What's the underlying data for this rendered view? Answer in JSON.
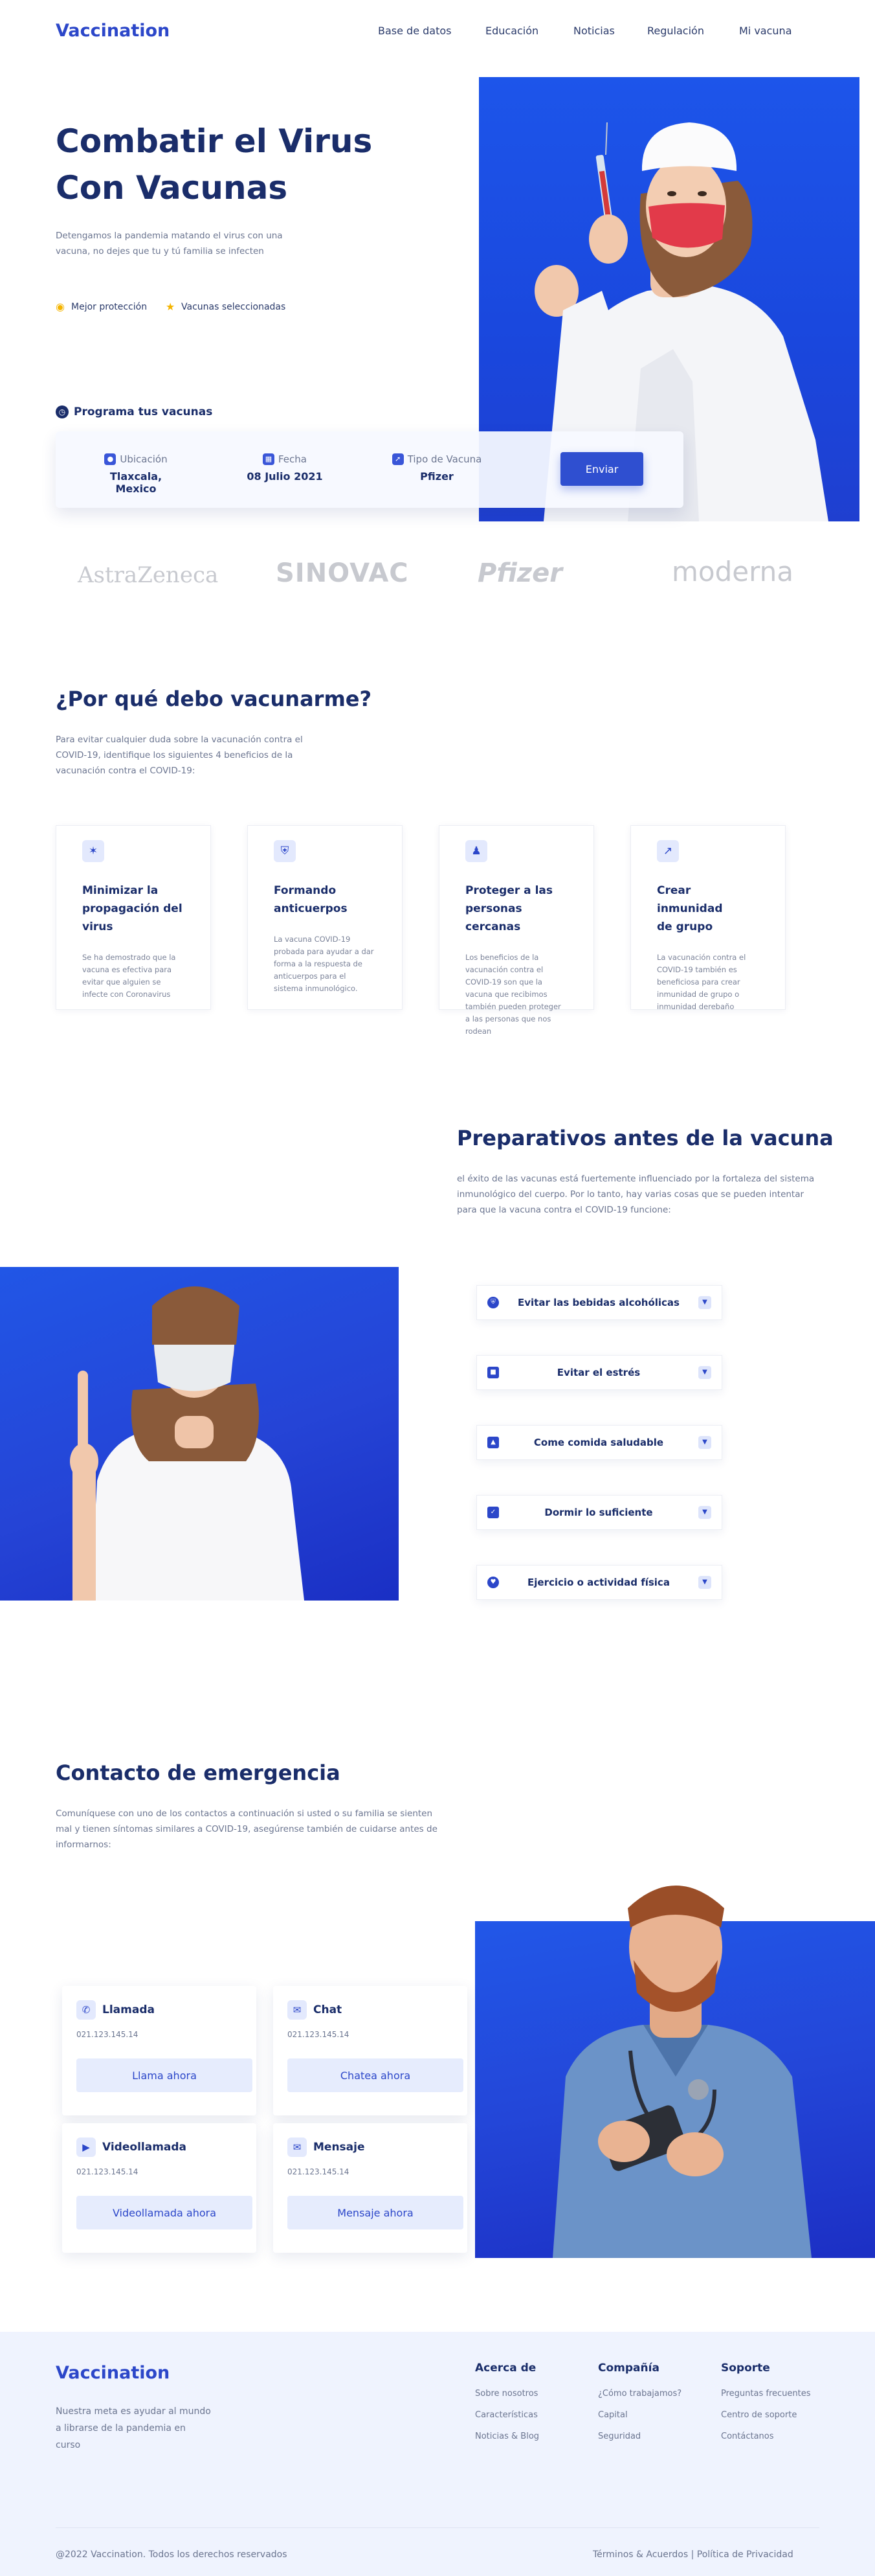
{
  "header": {
    "logo": "Vaccination",
    "nav": [
      "Base de datos",
      "Educación",
      "Noticias",
      "Regulación",
      "Mi vacuna"
    ]
  },
  "hero": {
    "title_line1": "Combatir el Virus",
    "title_line2": "Con Vacunas",
    "subtitle": "Detengamos la pandemia matando el virus con una vacuna, no dejes que tu y tú familia se infecten",
    "badges": [
      "Mejor protección",
      "Vacunas seleccionadas"
    ],
    "program_label": "Programa tus vacunas",
    "fields": [
      {
        "label": "Ubicación",
        "value": "Tlaxcala, Mexico",
        "icon": "location-pin-icon"
      },
      {
        "label": "Fecha",
        "value": "08 Julio 2021",
        "icon": "calendar-icon"
      },
      {
        "label": "Tipo de Vacuna",
        "value": "Pfizer",
        "icon": "syringe-icon"
      }
    ],
    "submit_label": "Enviar"
  },
  "brands": [
    "AstraZeneca",
    "SINOVAC",
    "Pfizer",
    "moderna"
  ],
  "why": {
    "title": "¿Por qué debo vacunarme?",
    "subtitle": "Para evitar cualquier duda sobre la vacunación contra el COVID-19, identifique los siguientes 4 beneficios de la vacunación contra el COVID-19:",
    "cards": [
      {
        "title_1": "Minimizar la",
        "title_2": "propagación del virus",
        "desc": "Se ha demostrado que la vacuna es efectiva para evitar que alguien se infecte con Coronavirus",
        "icon": "virus-icon"
      },
      {
        "title_1": "Formando",
        "title_2": "anticuerpos",
        "desc": "La vacuna COVID-19 probada para ayudar a dar forma a la respuesta de anticuerpos para el sistema inmunológico.",
        "icon": "shield-icon"
      },
      {
        "title_1": "Proteger a las",
        "title_2": "personas cercanas",
        "desc": "Los beneficios de la vacunación contra el COVID-19 son que la vacuna que recibimos también pueden proteger a las personas que nos rodean",
        "icon": "people-icon"
      },
      {
        "title_1": "Crear inmunidad",
        "title_2": "de grupo",
        "desc": "La vacunación contra el COVID-19 también es beneficiosa para crear inmunidad de grupo o inmunidad derebaño",
        "icon": "chart-icon"
      }
    ]
  },
  "prep": {
    "title": "Preparativos antes de la vacuna",
    "subtitle": "el éxito de las vacunas está fuertemente influenciado por la fortaleza del sistema inmunológico del cuerpo. Por lo tanto, hay varias cosas que se pueden intentar para que la vacuna contra el COVID-19 funcione:",
    "items": [
      "Evitar las bebidas alcohólicas",
      "Evitar el estrés",
      "Come comida saludable",
      "Dormir lo suficiente",
      "Ejercicio o actividad física"
    ]
  },
  "contact": {
    "title": "Contacto de emergencia",
    "subtitle": "Comuníquese con uno de los contactos a continuación si usted o su familia se sienten mal y tienen síntomas similares a COVID-19, asegúrense también de cuidarse antes de informarnos:",
    "cards": [
      {
        "title": "Llamada",
        "phone": "021.123.145.14",
        "button": "Llama ahora",
        "icon": "phone-icon"
      },
      {
        "title": "Chat",
        "phone": "021.123.145.14",
        "button": "Chatea ahora",
        "icon": "chat-icon"
      },
      {
        "title": "Videollamada",
        "phone": "021.123.145.14",
        "button": "Videollamada ahora",
        "icon": "video-icon"
      },
      {
        "title": "Mensaje",
        "phone": "021.123.145.14",
        "button": "Mensaje ahora",
        "icon": "mail-icon"
      }
    ]
  },
  "footer": {
    "logo": "Vaccination",
    "description": "Nuestra meta es ayudar al mundo a librarse de la pandemia en curso",
    "columns": [
      {
        "title": "Acerca de",
        "items": [
          "Sobre nosotros",
          "Características",
          "Noticias & Blog"
        ]
      },
      {
        "title": "Compañía",
        "items": [
          "¿Cómo trabajamos?",
          "Capital",
          "Seguridad"
        ]
      },
      {
        "title": "Soporte",
        "items": [
          "Preguntas frecuentes",
          "Centro de soporte",
          "Contáctanos"
        ]
      }
    ],
    "copyright": "@2022 Vaccination. Todos los derechos reservados",
    "legal": "Términos & Acuerdos | Política de Privacidad"
  },
  "colors": {
    "accent": "#2c47c9",
    "navy": "#1a2d6a",
    "hero_bg": "#1d55ea",
    "footer_bg": "#eff3fe"
  }
}
